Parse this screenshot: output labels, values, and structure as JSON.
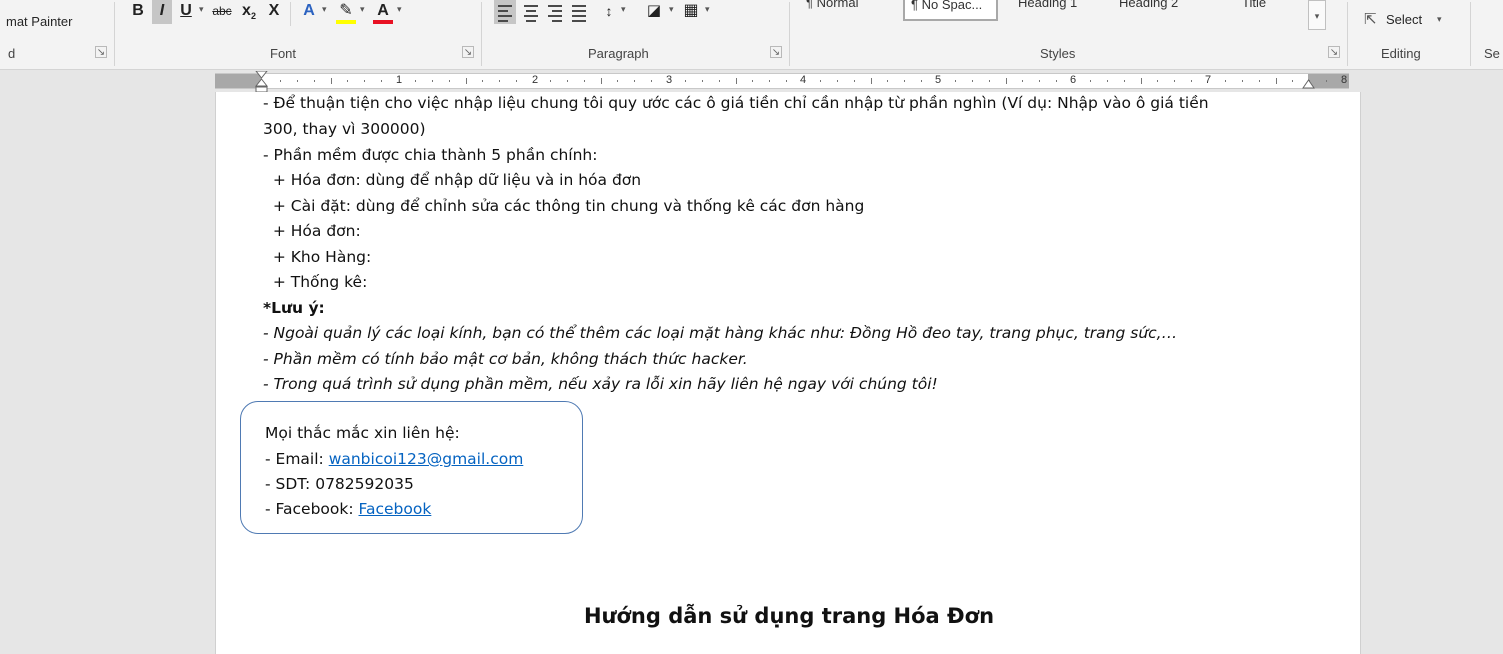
{
  "ribbon": {
    "clipboard": {
      "format_painter": "mat Painter",
      "group_fragment": "d"
    },
    "font": {
      "group_label": "Font",
      "bold": "B",
      "italic": "I",
      "underline": "U",
      "strikethrough": "abc",
      "subscript": "x",
      "subscript_mark": "2",
      "clear_formatting": "X",
      "text_effects": "A",
      "font_color": "A",
      "highlight_color": "#ffff00",
      "font_color_value": "#e81123"
    },
    "paragraph": {
      "group_label": "Paragraph"
    },
    "styles": {
      "group_label": "Styles",
      "items": [
        "¶ Normal",
        "¶ No Spac...",
        "Heading 1",
        "Heading 2",
        "Title"
      ]
    },
    "editing": {
      "group_label": "Editing",
      "select_label": "Select"
    },
    "next_group_fragment": "Se"
  },
  "ruler": {
    "numbers": [
      "1",
      "2",
      "3",
      "4",
      "5",
      "6",
      "7",
      "8"
    ]
  },
  "document": {
    "lines": [
      "- Để thuận tiện cho việc nhập liệu chung tôi quy ước các ô giá tiền chỉ cần nhập từ phần nghìn (Ví dụ: Nhập vào ô giá tiền",
      "300, thay vì 300000)",
      "- Phần mềm được chia thành 5 phần chính:",
      "  + Hóa đơn: dùng để nhập dữ liệu và in hóa đơn",
      "  + Cài đặt: dùng để chỉnh sửa các thông tin chung và thống kê các đơn hàng",
      "  + Hóa đơn:",
      "  + Kho Hàng:",
      "  + Thống kê:"
    ],
    "note_title": "*Lưu ý:",
    "note_lines": [
      "- Ngoài quản lý các loại kính, bạn có thể thêm các loại mặt hàng khác như: Đồng Hồ đeo tay, trang phục, trang sức,…",
      "- Phần mềm có tính bảo mật cơ bản, không thách thức hacker.",
      "- Trong quá trình sử dụng phần mềm, nếu xảy ra lỗi xin hãy liên hệ ngay với chúng tôi!"
    ],
    "contact": {
      "heading": "Mọi thắc mắc xin liên hệ:",
      "email_label": "- Email: ",
      "email_value": "wanbicoi123@gmail.com",
      "phone_line": "- SDT: 0782592035",
      "facebook_label": "- Facebook: ",
      "facebook_value": "Facebook"
    },
    "section_heading": "Hướng dẫn sử dụng trang Hóa Đơn"
  }
}
